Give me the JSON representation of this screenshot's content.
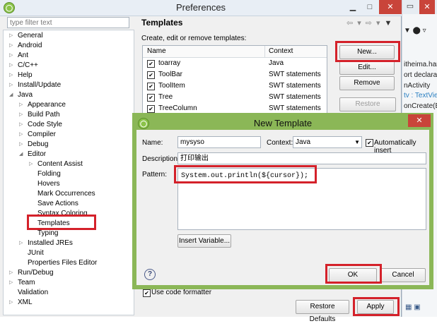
{
  "window": {
    "title": "Preferences"
  },
  "filter": {
    "placeholder": "type filter text"
  },
  "tree": [
    {
      "label": "General",
      "arrow": "▷"
    },
    {
      "label": "Android",
      "arrow": "▷"
    },
    {
      "label": "Ant",
      "arrow": "▷"
    },
    {
      "label": "C/C++",
      "arrow": "▷"
    },
    {
      "label": "Help",
      "arrow": "▷"
    },
    {
      "label": "Install/Update",
      "arrow": "▷"
    },
    {
      "label": "Java",
      "arrow": "◢"
    },
    {
      "label": "Appearance",
      "arrow": "▷"
    },
    {
      "label": "Build Path",
      "arrow": "▷"
    },
    {
      "label": "Code Style",
      "arrow": "▷"
    },
    {
      "label": "Compiler",
      "arrow": "▷"
    },
    {
      "label": "Debug",
      "arrow": "▷"
    },
    {
      "label": "Editor",
      "arrow": "◢"
    },
    {
      "label": "Content Assist",
      "arrow": "▷"
    },
    {
      "label": "Folding",
      "arrow": ""
    },
    {
      "label": "Hovers",
      "arrow": ""
    },
    {
      "label": "Mark Occurrences",
      "arrow": ""
    },
    {
      "label": "Save Actions",
      "arrow": ""
    },
    {
      "label": "Syntax Coloring",
      "arrow": ""
    },
    {
      "label": "Templates",
      "arrow": ""
    },
    {
      "label": "Typing",
      "arrow": ""
    },
    {
      "label": "Installed JREs",
      "arrow": "▷"
    },
    {
      "label": "JUnit",
      "arrow": ""
    },
    {
      "label": "Properties Files Editor",
      "arrow": ""
    },
    {
      "label": "Run/Debug",
      "arrow": "▷"
    },
    {
      "label": "Team",
      "arrow": "▷"
    },
    {
      "label": "Validation",
      "arrow": ""
    },
    {
      "label": "XML",
      "arrow": "▷"
    }
  ],
  "templates": {
    "title": "Templates",
    "description": "Create, edit or remove templates:",
    "columns": [
      "Name",
      "Context"
    ],
    "rows": [
      {
        "name": "toarray",
        "context": "Java",
        "checked": true
      },
      {
        "name": "ToolBar",
        "context": "SWT statements",
        "checked": true
      },
      {
        "name": "ToolItem",
        "context": "SWT statements",
        "checked": true
      },
      {
        "name": "Tree",
        "context": "SWT statements",
        "checked": true
      },
      {
        "name": "TreeColumn",
        "context": "SWT statements",
        "checked": true
      }
    ],
    "buttons": {
      "new": "New...",
      "edit": "Edit...",
      "remove": "Remove",
      "restore_removed": "Restore Removed"
    },
    "use_code_formatter": "Use code formatter",
    "restore_defaults": "Restore Defaults",
    "apply": "Apply"
  },
  "dialog": {
    "title": "New Template",
    "name_label": "Name:",
    "name_value": "mysyso",
    "context_label": "Context:",
    "context_value": "Java",
    "auto_insert_label": "Automatically insert",
    "auto_insert_checked": true,
    "description_label": "Description:",
    "description_value": "打印输出",
    "pattern_label": "Pattern:",
    "pattern_value": "System.out.println(${cursor});",
    "insert_variable": "Insert Variable...",
    "ok": "OK",
    "cancel": "Cancel"
  },
  "background_editor": [
    "itheima.har",
    "ort declarati",
    "nActivity",
    "tv : TextView",
    "onCreate(Bu"
  ],
  "colors": {
    "highlight": "#d4212a",
    "dialog_frame": "#8bb757"
  }
}
